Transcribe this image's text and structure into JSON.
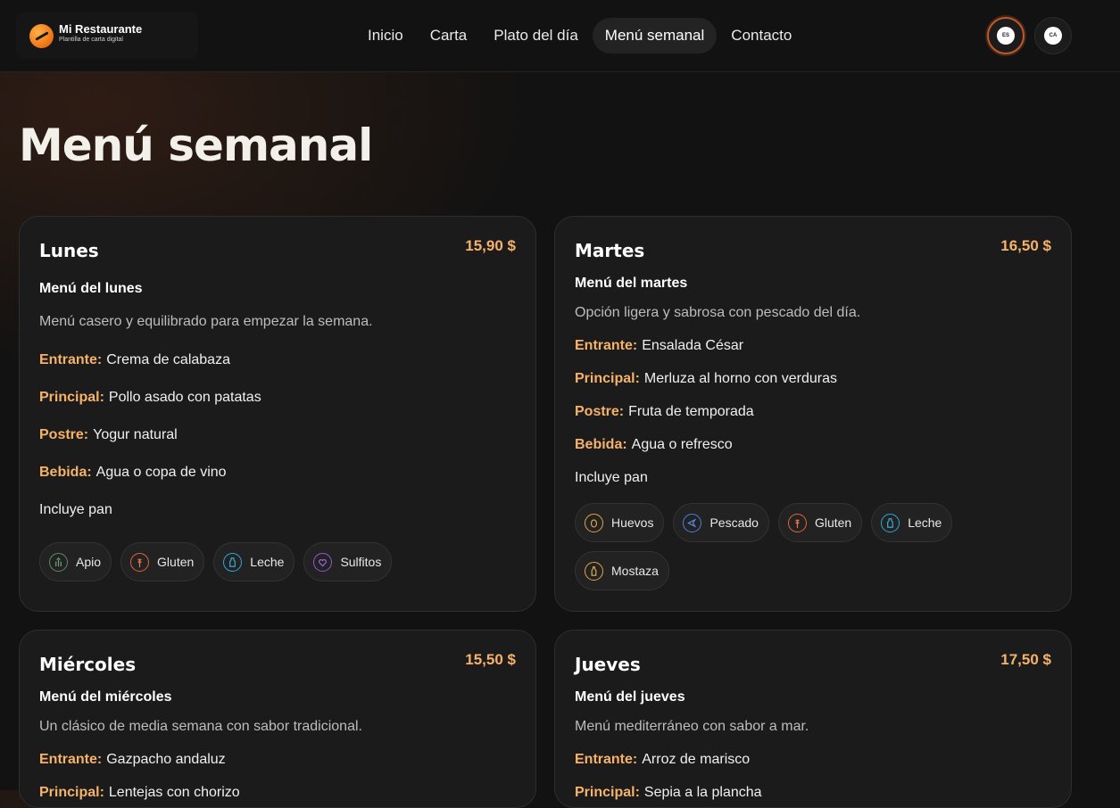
{
  "brand": {
    "name": "Mi Restaurante",
    "subtitle": "Plantilla de carta digital"
  },
  "nav": {
    "items": [
      {
        "label": "Inicio"
      },
      {
        "label": "Carta"
      },
      {
        "label": "Plato del día"
      },
      {
        "label": "Menú semanal",
        "active": true
      },
      {
        "label": "Contacto"
      }
    ]
  },
  "languages": [
    {
      "code": "ES",
      "active": true
    },
    {
      "code": "CA",
      "active": false
    }
  ],
  "page": {
    "title": "Menú semanal"
  },
  "labels": {
    "starter": "Entrante:",
    "main": "Principal:",
    "dessert": "Postre:",
    "drink": "Bebida:"
  },
  "menus": [
    {
      "day": "Lunes",
      "price": "15,90 $",
      "name": "Menú del lunes",
      "description": "Menú casero y equilibrado para empezar la semana.",
      "starter": "Crema de calabaza",
      "main": "Pollo asado con patatas",
      "dessert": "Yogur natural",
      "drink": "Agua o copa de vino",
      "note": "Incluye pan",
      "allergens": [
        {
          "label": "Apio",
          "icon": "celery-icon",
          "color": "#5f8a68"
        },
        {
          "label": "Gluten",
          "icon": "wheat-icon",
          "color": "#e0663a"
        },
        {
          "label": "Leche",
          "icon": "milk-bottle-icon",
          "color": "#2ea7d6"
        },
        {
          "label": "Sulfitos",
          "icon": "sulfites-icon",
          "color": "#9a55d6"
        }
      ]
    },
    {
      "day": "Martes",
      "price": "16,50 $",
      "name": "Menú del martes",
      "description": "Opción ligera y sabrosa con pescado del día.",
      "starter": "Ensalada César",
      "main": "Merluza al horno con verduras",
      "dessert": "Fruta de temporada",
      "drink": "Agua o refresco",
      "note": "Incluye pan",
      "allergens": [
        {
          "label": "Huevos",
          "icon": "egg-icon",
          "color": "#e0a64a"
        },
        {
          "label": "Pescado",
          "icon": "fish-icon",
          "color": "#4d7fe0"
        },
        {
          "label": "Gluten",
          "icon": "wheat-icon",
          "color": "#e0663a"
        },
        {
          "label": "Leche",
          "icon": "milk-bottle-icon",
          "color": "#2ea7d6"
        },
        {
          "label": "Mostaza",
          "icon": "mustard-icon",
          "color": "#e0a64a"
        }
      ]
    },
    {
      "day": "Miércoles",
      "price": "15,50 $",
      "name": "Menú del miércoles",
      "description": "Un clásico de media semana con sabor tradicional.",
      "starter": "Gazpacho andaluz",
      "main": "Lentejas con chorizo"
    },
    {
      "day": "Jueves",
      "price": "17,50 $",
      "name": "Menú del jueves",
      "description": "Menú mediterráneo con sabor a mar.",
      "starter": "Arroz de marisco",
      "main": "Sepia a la plancha"
    }
  ]
}
